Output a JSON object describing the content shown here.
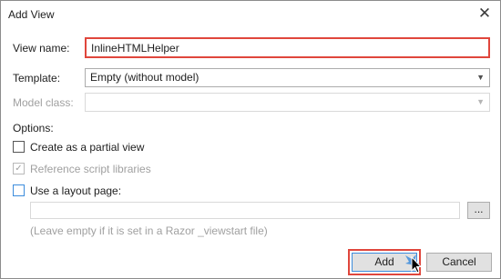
{
  "window": {
    "title": "Add View",
    "close_glyph": "✕"
  },
  "form": {
    "view_name": {
      "label": "View name:",
      "value": "InlineHTMLHelper"
    },
    "template": {
      "label": "Template:",
      "value": "Empty (without model)"
    },
    "model_class": {
      "label": "Model class:",
      "value": ""
    },
    "options_label": "Options:",
    "partial_view": {
      "label": "Create as a partial view",
      "checked": false
    },
    "reference_scripts": {
      "label": "Reference script libraries",
      "checked": true,
      "check_glyph": "✓"
    },
    "layout_page": {
      "label": "Use a layout page:",
      "checked": false
    },
    "layout_path": {
      "value": ""
    },
    "browse_label": "...",
    "hint": "(Leave empty if it is set in a Razor _viewstart file)"
  },
  "buttons": {
    "add": "Add",
    "cancel": "Cancel"
  },
  "icons": {
    "caret": "chevron-down-icon",
    "cursor": "mouse-pointer-icon"
  },
  "colors": {
    "highlight": "#e0463c",
    "focus": "#3c8cdc"
  }
}
